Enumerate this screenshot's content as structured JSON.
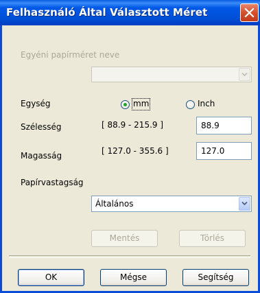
{
  "window": {
    "title": "Felhasználó Által Választott Méret",
    "close_icon": "close-icon"
  },
  "custom_name": {
    "label": "Egyéni papírméret neve",
    "value": ""
  },
  "unit": {
    "label": "Egység",
    "options": [
      {
        "label": "mm",
        "selected": true
      },
      {
        "label": "Inch",
        "selected": false
      }
    ]
  },
  "width": {
    "label": "Szélesség",
    "range": "[ 88.9 - 215.9 ]",
    "value": "88.9"
  },
  "height": {
    "label": "Magasság",
    "range": "[ 127.0 - 355.6 ]",
    "value": "127.0"
  },
  "thickness": {
    "label": "Papírvastagság",
    "selected": "Általános"
  },
  "actions": {
    "save": "Mentés",
    "delete": "Törlés"
  },
  "footer": {
    "ok": "OK",
    "cancel": "Mégse",
    "help": "Segítség"
  },
  "colors": {
    "titlebar": "#0058e6",
    "dialog_bg": "#ece9d8",
    "close_button": "#d4502c",
    "radio_selected": "#21a121"
  }
}
